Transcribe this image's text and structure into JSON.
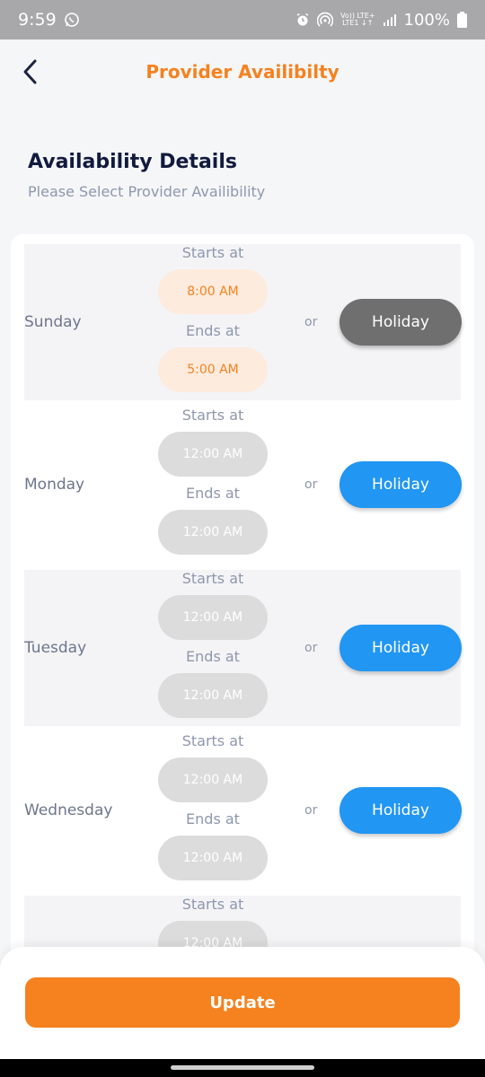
{
  "status_bar": {
    "time": "9:59",
    "network_top": "Vo)) LTE+",
    "network_bottom": "LTE1 ↓↑",
    "battery": "100%"
  },
  "app_bar": {
    "title": "Provider Availibilty"
  },
  "section": {
    "title": "Availability Details",
    "subtitle": "Please Select Provider Availibility"
  },
  "days": [
    {
      "name": "Sunday",
      "starts_label": "Starts at",
      "start": "8:00 AM",
      "ends_label": "Ends at",
      "end": "5:00 AM",
      "or": "or",
      "holiday": "Holiday"
    },
    {
      "name": "Monday",
      "starts_label": "Starts at",
      "start": "12:00 AM",
      "ends_label": "Ends at",
      "end": "12:00 AM",
      "or": "or",
      "holiday": "Holiday"
    },
    {
      "name": "Tuesday",
      "starts_label": "Starts at",
      "start": "12:00 AM",
      "ends_label": "Ends at",
      "end": "12:00 AM",
      "or": "or",
      "holiday": "Holiday"
    },
    {
      "name": "Wednesday",
      "starts_label": "Starts at",
      "start": "12:00 AM",
      "ends_label": "Ends at",
      "end": "12:00 AM",
      "or": "or",
      "holiday": "Holiday"
    },
    {
      "name": "",
      "starts_label": "Starts at",
      "start": "12:00 AM"
    }
  ],
  "footer": {
    "update_label": "Update"
  },
  "colors": {
    "accent": "#f5821f",
    "holiday_active": "#6f6f6f",
    "holiday_default": "#2196f3"
  },
  "icons": {
    "back": "back-arrow-icon",
    "whatsapp": "whatsapp-icon",
    "alarm": "alarm-icon",
    "hotspot": "hotspot-icon",
    "signal": "signal-icon",
    "battery": "battery-icon"
  }
}
